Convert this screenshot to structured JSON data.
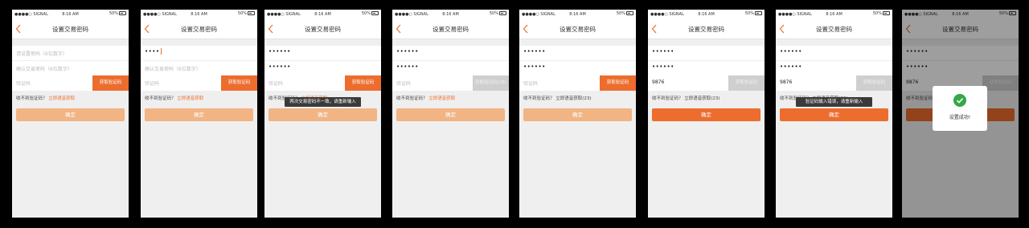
{
  "status_bar": {
    "carrier": "●●●●○ SIGNAL",
    "time": "8:16 AM",
    "battery": "50%"
  },
  "nav": {
    "title": "设置交易密码"
  },
  "placeholders": {
    "password": "请设置密码（6位数字）",
    "confirm": "确认交易密码（6位数字）",
    "code": "验证码"
  },
  "values": {
    "dots4": "••••",
    "dots6": "••••••",
    "code": "9876"
  },
  "buttons": {
    "get_code": "获取验证码",
    "countdown_28": "获取验证码(28)",
    "confirm": "确定"
  },
  "voice": {
    "prompt": "收不到验证码？",
    "link": "立即语音获取",
    "countdown_23": "收不到验证码？ 立即语音获取(23)"
  },
  "toasts": {
    "mismatch": "两次交易密码不一致，请重新输入",
    "code_error": "验证码输入错误，请重新输入"
  },
  "success": {
    "text": "设置成功!"
  },
  "colors": {
    "accent": "#ec6d2e",
    "accent_light": "#f2b483",
    "disabled": "#cfcfcf",
    "success": "#36a84a"
  }
}
